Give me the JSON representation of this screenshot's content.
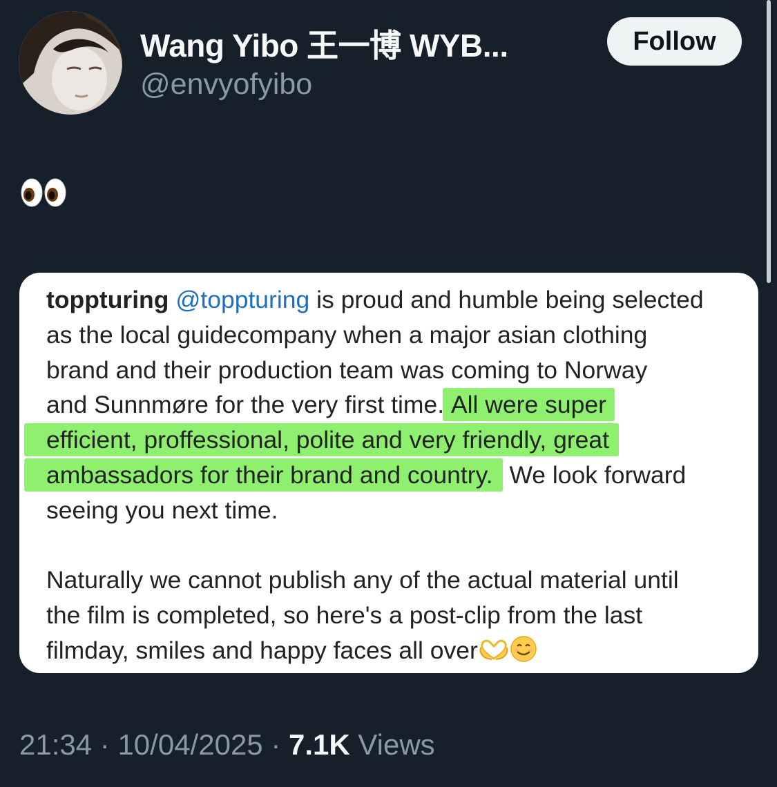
{
  "tweet": {
    "display_name": "Wang Yibo 王一博 WYB...",
    "handle": "@envyofyibo",
    "follow_label": "Follow",
    "body_emoji_name": "eyes-emoji"
  },
  "quoted_screenshot": {
    "author": "toppturing",
    "mention": "@toppturing",
    "lines": [
      " is proud and humble being selected",
      "as the local guidecompany when a major asian clothing",
      "brand and their production team was coming to Norway",
      "and Sunnmøre for the very first time. ",
      "All were super",
      "efficient, proffessional, polite and very friendly, great",
      "ambassadors for their brand and country.",
      " We look forward",
      "seeing you next time.",
      "Naturally we cannot publish any of the actual material until",
      "the film is completed, so here's a post-clip from the last",
      "filmday, smiles and happy faces all over"
    ],
    "highlight_color": "#8fef6e",
    "trailing_emojis": [
      "heart-hands-emoji",
      "smiling-face-emoji"
    ]
  },
  "meta": {
    "time": "21:34",
    "separator": "·",
    "date": "10/04/2025",
    "views_count": "7.1K",
    "views_label": "Views"
  },
  "colors": {
    "background": "#15202b",
    "text_primary": "#f7f9f9",
    "text_secondary": "#8b98a5",
    "follow_bg": "#eff3f4",
    "mention": "#1d6fc2"
  }
}
